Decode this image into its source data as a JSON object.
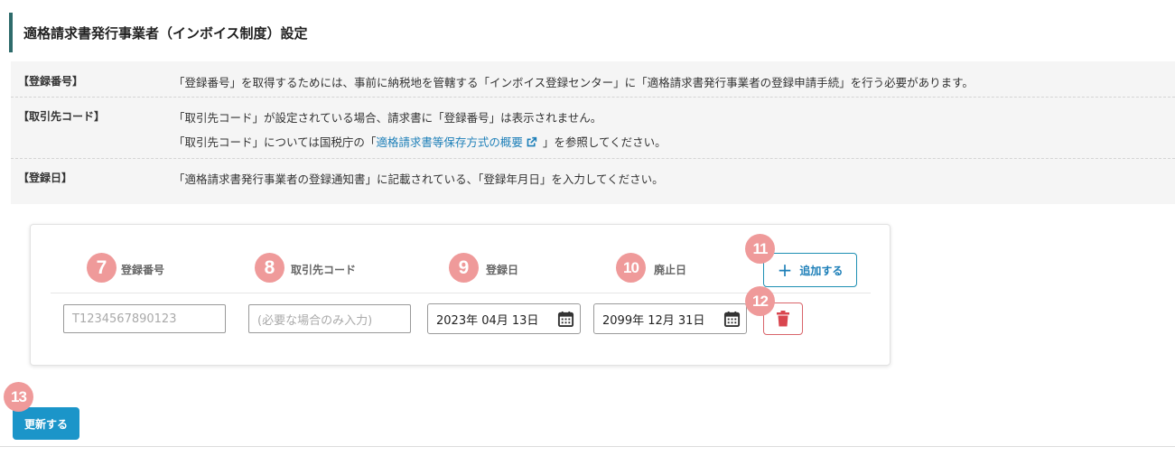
{
  "page_title": "適格請求書発行事業者（インボイス制度）設定",
  "info": {
    "row1": {
      "label": "【登録番号】",
      "text": "「登録番号」を取得するためには、事前に納税地を管轄する「インボイス登録センター」に「適格請求書発行事業者の登録申請手続」を行う必要があります。"
    },
    "row2": {
      "label": "【取引先コード】",
      "line1": "「取引先コード」が設定されている場合、請求書に「登録番号」は表示されません。",
      "line2_prefix": "「取引先コード」については国税庁の「",
      "line2_link": "適格請求書等保存方式の概要",
      "line2_suffix": "」を参照してください。"
    },
    "row3": {
      "label": "【登録日】",
      "text": "「適格請求書発行事業者の登録通知書」に記載されている、「登録年月日」を入力してください。"
    }
  },
  "columns": {
    "registration_number": "登録番号",
    "partner_code": "取引先コード",
    "registration_date": "登録日",
    "abolition_date": "廃止日"
  },
  "row": {
    "registration_number_placeholder": "T1234567890123",
    "partner_code_placeholder": "(必要な場合のみ入力)",
    "registration_date_value": "2023年 04月 13日",
    "abolition_date_value": "2099年 12月 31日"
  },
  "buttons": {
    "add": "追加する",
    "update": "更新する"
  },
  "badges": {
    "b7": "7",
    "b8": "8",
    "b9": "9",
    "b10": "10",
    "b11": "11",
    "b12": "12",
    "b13": "13"
  },
  "colors": {
    "accent": "#1b95c9",
    "badge": "#ef9a9a",
    "delete": "#d9464f",
    "title_border": "#2e6b6b"
  },
  "icons": [
    "external-link-icon",
    "calendar-icon",
    "plus-icon",
    "trash-icon"
  ]
}
